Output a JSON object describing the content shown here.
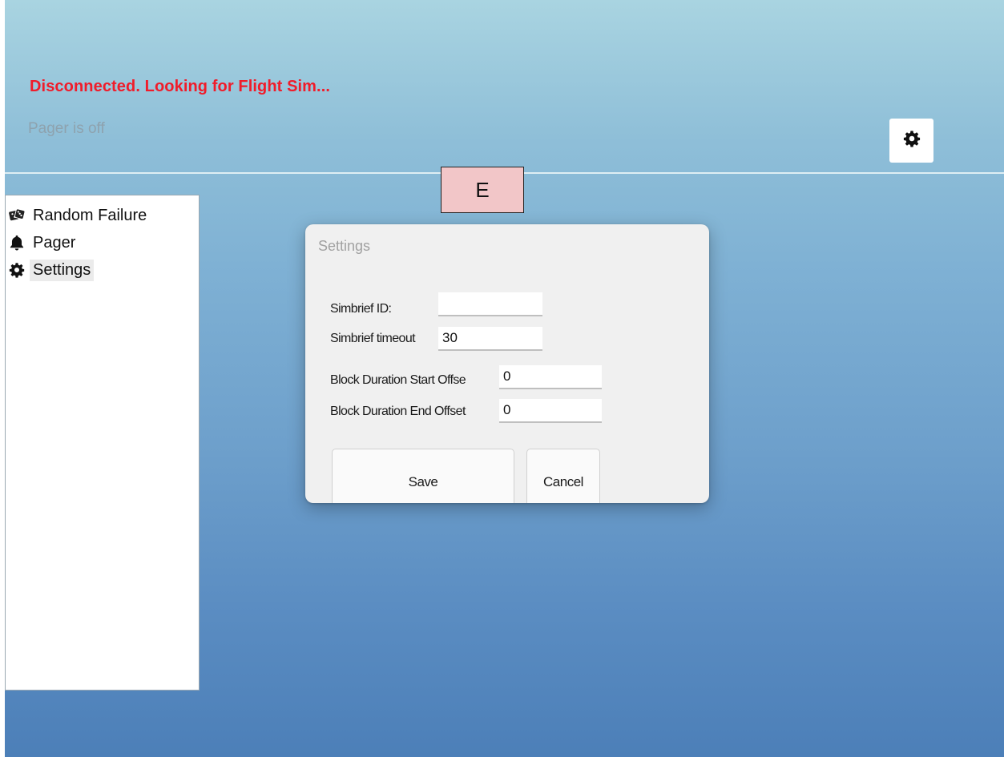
{
  "header": {
    "connection_status": "Disconnected. Looking for Flight Sim...",
    "pager_status": "Pager is off",
    "settings_button_icon": "gear-icon"
  },
  "colors": {
    "status_error": "#f01c2a",
    "marker_fill": "#f2c6c8"
  },
  "sidebar": {
    "items": [
      {
        "label": "Random Failure",
        "icon": "dice-icon"
      },
      {
        "label": "Pager",
        "icon": "bell-icon"
      },
      {
        "label": "Settings",
        "icon": "gear-icon",
        "selected": true
      }
    ]
  },
  "marker": {
    "label": "E"
  },
  "dialog": {
    "title": "Settings",
    "fields": {
      "simbrief_id": {
        "label": "Simbrief ID:",
        "value": ""
      },
      "simbrief_timeout": {
        "label": "Simbrief timeout",
        "value": "30"
      },
      "block_start_offset": {
        "label": "Block Duration Start Offse",
        "value": "0"
      },
      "block_end_offset": {
        "label": "Block Duration End Offset",
        "value": "0"
      }
    },
    "buttons": {
      "save": "Save",
      "cancel": "Cancel"
    }
  }
}
